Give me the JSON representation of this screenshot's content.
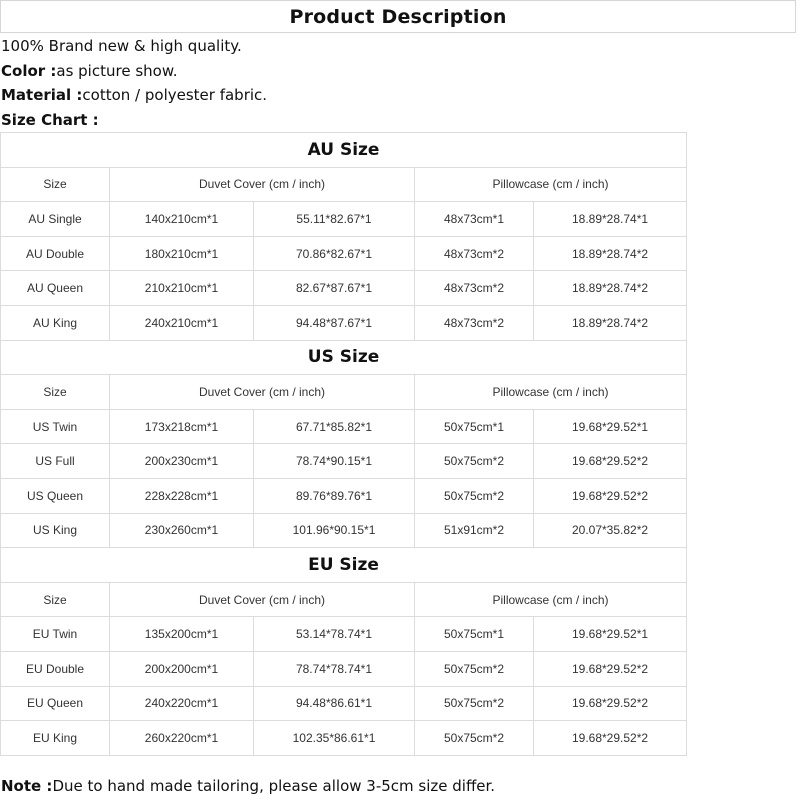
{
  "title": "Product Description",
  "description": {
    "line1": "100% Brand new & high quality.",
    "color_label": "Color :",
    "color_value": "as picture show.",
    "material_label": "Material :",
    "material_value": "cotton / polyester fabric.",
    "size_chart_label": "Size Chart :"
  },
  "table": {
    "header_size": "Size",
    "header_duvet": "Duvet Cover (cm / inch)",
    "header_pillow": "Pillowcase (cm / inch)",
    "sections": [
      {
        "title": "AU Size",
        "rows": [
          [
            "AU Single",
            "140x210cm*1",
            "55.11*82.67*1",
            "48x73cm*1",
            "18.89*28.74*1"
          ],
          [
            "AU Double",
            "180x210cm*1",
            "70.86*82.67*1",
            "48x73cm*2",
            "18.89*28.74*2"
          ],
          [
            "AU Queen",
            "210x210cm*1",
            "82.67*87.67*1",
            "48x73cm*2",
            "18.89*28.74*2"
          ],
          [
            "AU King",
            "240x210cm*1",
            "94.48*87.67*1",
            "48x73cm*2",
            "18.89*28.74*2"
          ]
        ]
      },
      {
        "title": "US Size",
        "rows": [
          [
            "US Twin",
            "173x218cm*1",
            "67.71*85.82*1",
            "50x75cm*1",
            "19.68*29.52*1"
          ],
          [
            "US Full",
            "200x230cm*1",
            "78.74*90.15*1",
            "50x75cm*2",
            "19.68*29.52*2"
          ],
          [
            "US Queen",
            "228x228cm*1",
            "89.76*89.76*1",
            "50x75cm*2",
            "19.68*29.52*2"
          ],
          [
            "US King",
            "230x260cm*1",
            "101.96*90.15*1",
            "51x91cm*2",
            "20.07*35.82*2"
          ]
        ]
      },
      {
        "title": "EU Size",
        "rows": [
          [
            "EU Twin",
            "135x200cm*1",
            "53.14*78.74*1",
            "50x75cm*1",
            "19.68*29.52*1"
          ],
          [
            "EU Double",
            "200x200cm*1",
            "78.74*78.74*1",
            "50x75cm*2",
            "19.68*29.52*2"
          ],
          [
            "EU Queen",
            "240x220cm*1",
            "94.48*86.61*1",
            "50x75cm*2",
            "19.68*29.52*2"
          ],
          [
            "EU King",
            "260x220cm*1",
            "102.35*86.61*1",
            "50x75cm*2",
            "19.68*29.52*2"
          ]
        ]
      }
    ]
  },
  "note": {
    "label": "Note :",
    "text": "Due to hand made tailoring, please allow 3-5cm size differ."
  }
}
